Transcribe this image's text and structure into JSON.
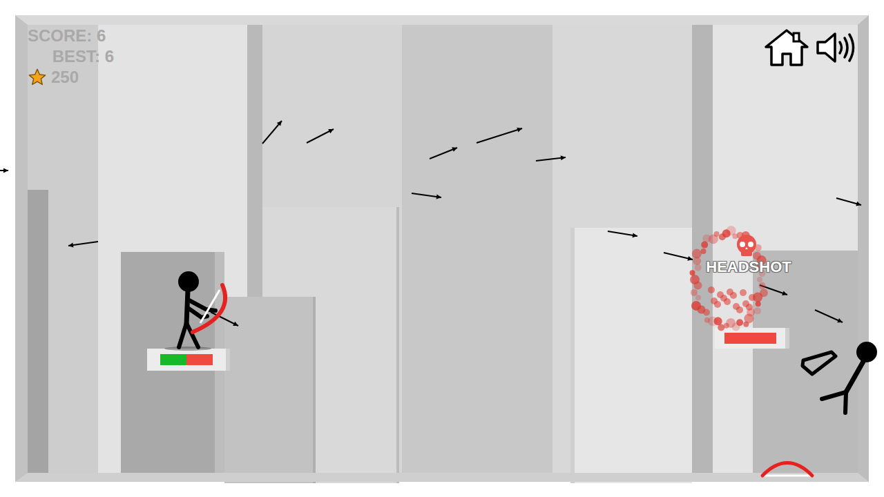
{
  "hud": {
    "score": "SCORE: 6",
    "best": "BEST: 6",
    "stars": "250"
  },
  "player": {
    "health": {
      "level": 0.5
    }
  },
  "enemy": {
    "health": {
      "level": 0
    }
  },
  "effect": {
    "label": "HEADSHOT"
  },
  "controls": {
    "sound_on": true
  }
}
